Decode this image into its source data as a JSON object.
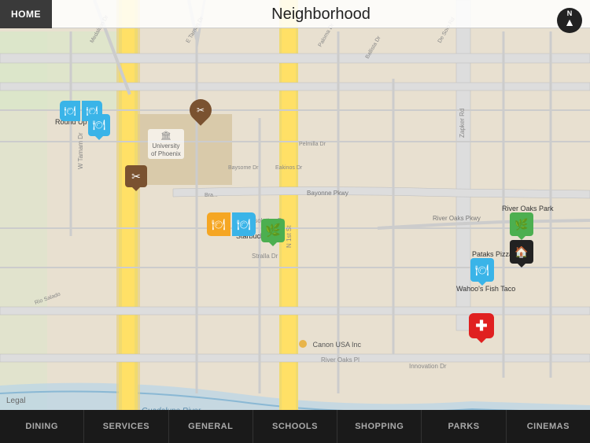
{
  "header": {
    "home_label": "HOME",
    "title": "Neighborhood"
  },
  "nav": {
    "items": [
      {
        "id": "dining",
        "label": "DINING"
      },
      {
        "id": "services",
        "label": "SERVICES"
      },
      {
        "id": "general",
        "label": "GENERAL"
      },
      {
        "id": "schools",
        "label": "SCHOOLS"
      },
      {
        "id": "shopping",
        "label": "SHOPPING"
      },
      {
        "id": "parks",
        "label": "PARKS"
      },
      {
        "id": "cinemas",
        "label": "CINEMAS"
      }
    ]
  },
  "map": {
    "legal": "Legal",
    "places": [
      {
        "id": "univ",
        "label": "University\nof Phoenix"
      },
      {
        "id": "canon",
        "label": "Canon USA Inc"
      },
      {
        "id": "pataks",
        "label": "Pataks Pizza"
      },
      {
        "id": "wahoo",
        "label": "Wahoo's Fish Taco"
      },
      {
        "id": "starbucks",
        "label": "Starbucks"
      },
      {
        "id": "roundup",
        "label": "Round Up Pizza"
      },
      {
        "id": "river_oaks",
        "label": "River Oaks Park"
      },
      {
        "id": "river_oaks_pkwy",
        "label": "River Oaks Pkwy"
      }
    ],
    "roads": [
      "W Tamam Dr",
      "N 1st St",
      "Bayonne Pkwy",
      "N 1st St",
      "Zapker Rd",
      "E Tarnan Dr"
    ]
  },
  "markers": {
    "dining_blue": {
      "icon": "🍽",
      "color": "#3ab4e8"
    },
    "dining_orange": {
      "icon": "🍽",
      "color": "#f5a623"
    },
    "services_brown": {
      "icon": "✂",
      "color": "#8b6340"
    },
    "home_dark": {
      "icon": "🏠",
      "color": "#2a2a2a"
    },
    "park_green": {
      "icon": "🌿",
      "color": "#4caf50"
    },
    "medical_red": {
      "icon": "✚",
      "color": "#e02020"
    }
  }
}
